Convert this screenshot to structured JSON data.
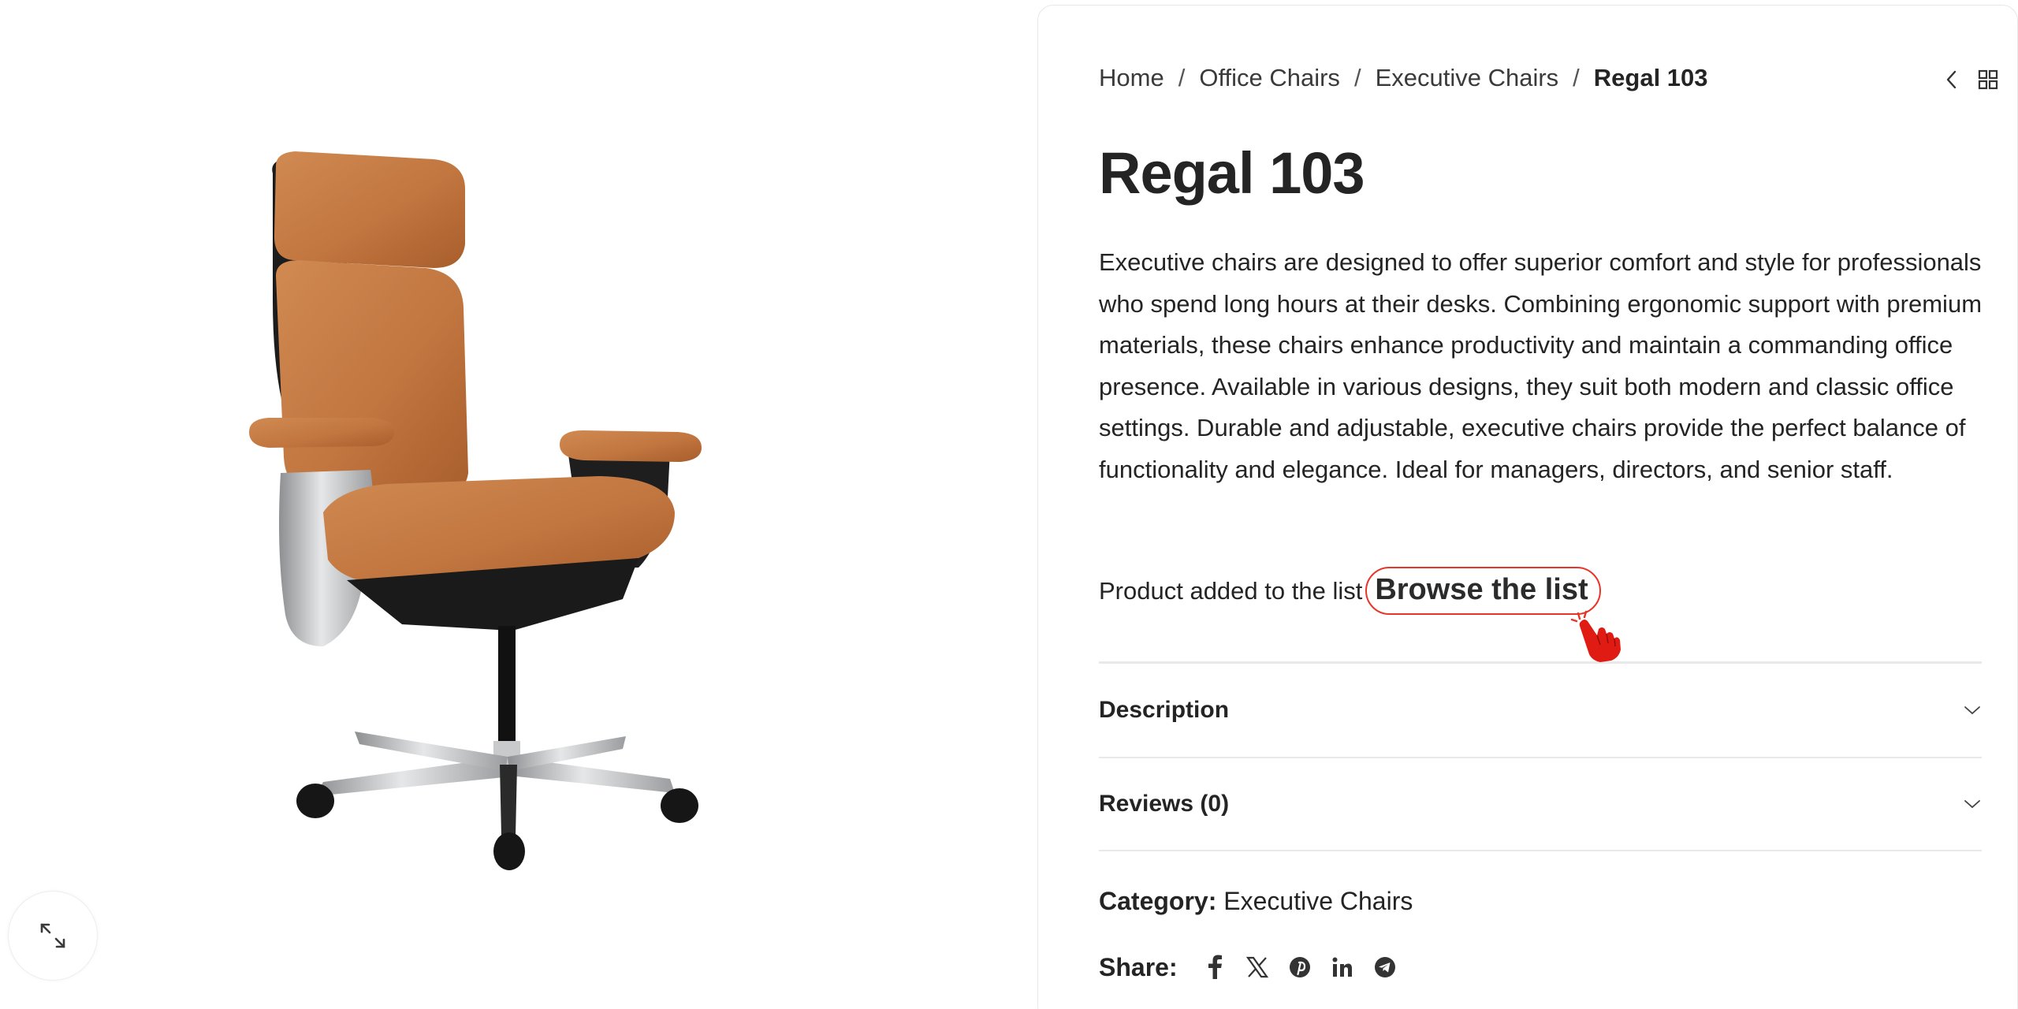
{
  "gallery": {
    "image_alt": "Regal 103 executive office chair in tan leather",
    "zoom_icon": "expand-icon"
  },
  "breadcrumb": {
    "items": [
      "Home",
      "Office Chairs",
      "Executive Chairs"
    ],
    "separator": "/",
    "current": "Regal 103"
  },
  "product_nav": {
    "prev_icon": "chevron-left-icon",
    "grid_icon": "grid-icon",
    "next_icon": "chevron-right-icon"
  },
  "product": {
    "title": "Regal 103",
    "description": "Executive chairs are designed to offer superior comfort and style for professionals who spend long hours at their desks. Combining ergonomic support with premium materials, these chairs enhance productivity and maintain a commanding office presence. Available in various designs, they suit both modern and classic office settings. Durable and adjustable, executive chairs provide the perfect balance of functionality and elegance. Ideal for managers, directors, and senior staff."
  },
  "wishlist": {
    "added_text": "Product added to the list",
    "browse_label": "Browse the list",
    "highlight_color": "#e8352a"
  },
  "tabs": [
    {
      "label": "Description"
    },
    {
      "label": "Reviews (0)"
    }
  ],
  "meta": {
    "category_label": "Category:",
    "category_value": "Executive Chairs",
    "share_label": "Share:",
    "share_icons": [
      "facebook-icon",
      "x-icon",
      "pinterest-icon",
      "linkedin-icon",
      "telegram-icon"
    ]
  },
  "colors": {
    "text": "#242424",
    "border": "#e9e9e9",
    "leather": "#c47a42",
    "accent_red": "#e8352a"
  }
}
